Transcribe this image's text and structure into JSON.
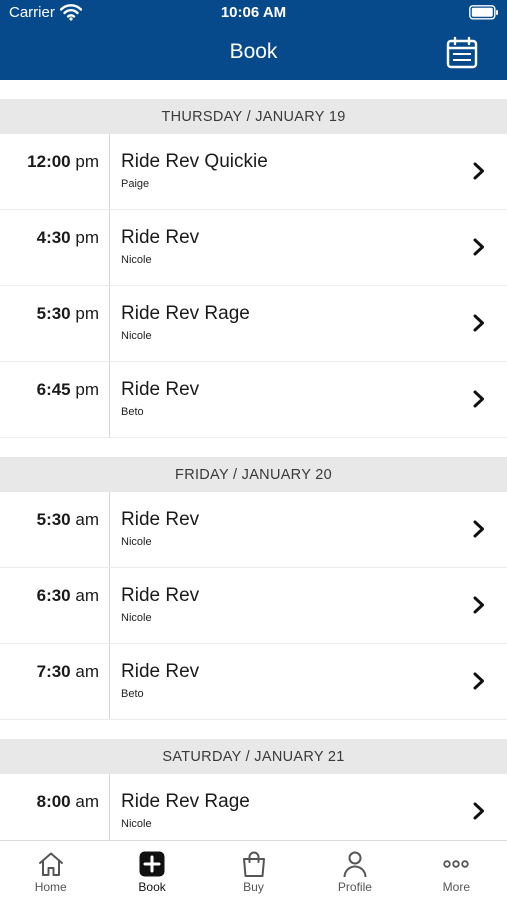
{
  "status": {
    "carrier": "Carrier",
    "time": "10:06 AM"
  },
  "header": {
    "title": "Book"
  },
  "sections": [
    {
      "date": "THURSDAY / JANUARY 19",
      "rows": [
        {
          "time": "12:00",
          "ampm": "pm",
          "class": "Ride Rev Quickie",
          "instructor": "Paige"
        },
        {
          "time": "4:30",
          "ampm": "pm",
          "class": "Ride Rev",
          "instructor": "Nicole"
        },
        {
          "time": "5:30",
          "ampm": "pm",
          "class": "Ride Rev Rage",
          "instructor": "Nicole"
        },
        {
          "time": "6:45",
          "ampm": "pm",
          "class": "Ride Rev",
          "instructor": "Beto"
        }
      ]
    },
    {
      "date": "FRIDAY / JANUARY 20",
      "rows": [
        {
          "time": "5:30",
          "ampm": "am",
          "class": "Ride Rev",
          "instructor": "Nicole"
        },
        {
          "time": "6:30",
          "ampm": "am",
          "class": "Ride Rev",
          "instructor": "Nicole"
        },
        {
          "time": "7:30",
          "ampm": "am",
          "class": "Ride Rev",
          "instructor": "Beto"
        }
      ]
    },
    {
      "date": "SATURDAY / JANUARY 21",
      "rows": [
        {
          "time": "8:00",
          "ampm": "am",
          "class": "Ride Rev Rage",
          "instructor": "Nicole"
        }
      ]
    }
  ],
  "tabs": [
    {
      "label": "Home",
      "icon": "home-icon"
    },
    {
      "label": "Book",
      "icon": "plus-square-icon",
      "active": true
    },
    {
      "label": "Buy",
      "icon": "shopping-bag-icon"
    },
    {
      "label": "Profile",
      "icon": "person-icon"
    },
    {
      "label": "More",
      "icon": "ellipsis-icon"
    }
  ],
  "colors": {
    "header": "#064a8c",
    "section_bg": "#e8e8e8"
  }
}
